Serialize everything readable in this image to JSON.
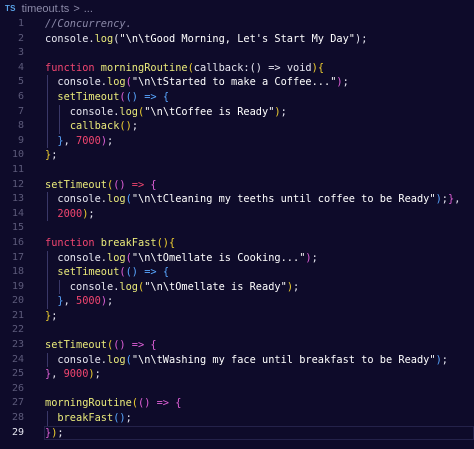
{
  "tab": {
    "language_badge": "TS",
    "filename": "timeout.ts",
    "breadcrumb_sep": ">",
    "breadcrumb_more": "..."
  },
  "lines": [
    {
      "n": "1",
      "tokens": [
        {
          "t": "//Concurrency.",
          "c": "comment"
        }
      ]
    },
    {
      "n": "2",
      "tokens": [
        {
          "t": "console.",
          "c": "plain"
        },
        {
          "t": "log",
          "c": "fn"
        },
        {
          "t": "(",
          "c": "paren"
        },
        {
          "t": "\"\\n\\tGood Morning, Let's Start My Day\"",
          "c": "str"
        },
        {
          "t": ");",
          "c": "plain"
        }
      ]
    },
    {
      "n": "3",
      "tokens": []
    },
    {
      "n": "4",
      "tokens": [
        {
          "t": "function ",
          "c": "kw"
        },
        {
          "t": "morningRoutine",
          "c": "fn"
        },
        {
          "t": "(",
          "c": "brace-y"
        },
        {
          "t": "callback",
          "c": "param"
        },
        {
          "t": ":() => ",
          "c": "plain"
        },
        {
          "t": "void",
          "c": "plain"
        },
        {
          "t": ")",
          "c": "brace-y"
        },
        {
          "t": "{",
          "c": "brace-y"
        }
      ]
    },
    {
      "n": "5",
      "tokens": [
        {
          "t": "  console.",
          "c": "plain"
        },
        {
          "t": "log",
          "c": "fn"
        },
        {
          "t": "(",
          "c": "brace-p"
        },
        {
          "t": "\"\\n\\tStarted to make a Coffee...\"",
          "c": "str"
        },
        {
          "t": ")",
          "c": "brace-p"
        },
        {
          "t": ";",
          "c": "plain"
        }
      ]
    },
    {
      "n": "6",
      "tokens": [
        {
          "t": "  ",
          "c": "plain"
        },
        {
          "t": "setTimeout",
          "c": "fn"
        },
        {
          "t": "(",
          "c": "brace-p"
        },
        {
          "t": "() => ",
          "c": "brace-b"
        },
        {
          "t": "{",
          "c": "brace-b"
        }
      ]
    },
    {
      "n": "7",
      "tokens": [
        {
          "t": "    console.",
          "c": "plain"
        },
        {
          "t": "log",
          "c": "fn"
        },
        {
          "t": "(",
          "c": "brace-y"
        },
        {
          "t": "\"\\n\\tCoffee is Ready\"",
          "c": "str"
        },
        {
          "t": ")",
          "c": "brace-y"
        },
        {
          "t": ";",
          "c": "plain"
        }
      ]
    },
    {
      "n": "8",
      "tokens": [
        {
          "t": "    ",
          "c": "plain"
        },
        {
          "t": "callback",
          "c": "fn"
        },
        {
          "t": "()",
          "c": "brace-y"
        },
        {
          "t": ";",
          "c": "plain"
        }
      ]
    },
    {
      "n": "9",
      "tokens": [
        {
          "t": "  ",
          "c": "plain"
        },
        {
          "t": "}",
          "c": "brace-b"
        },
        {
          "t": ", ",
          "c": "plain"
        },
        {
          "t": "7000",
          "c": "num"
        },
        {
          "t": ")",
          "c": "brace-p"
        },
        {
          "t": ";",
          "c": "plain"
        }
      ]
    },
    {
      "n": "10",
      "tokens": [
        {
          "t": "}",
          "c": "brace-y"
        },
        {
          "t": ";",
          "c": "plain"
        }
      ]
    },
    {
      "n": "11",
      "tokens": []
    },
    {
      "n": "12",
      "tokens": [
        {
          "t": "setTimeout",
          "c": "fn"
        },
        {
          "t": "(",
          "c": "brace-y"
        },
        {
          "t": "()",
          "c": "brace-p"
        },
        {
          "t": " => ",
          "c": "kw"
        },
        {
          "t": "{",
          "c": "brace-p"
        }
      ]
    },
    {
      "n": "13",
      "tokens": [
        {
          "t": "  console.",
          "c": "plain"
        },
        {
          "t": "log",
          "c": "fn"
        },
        {
          "t": "(",
          "c": "brace-b"
        },
        {
          "t": "\"\\n\\tCleaning my teeths until coffee to be Ready\"",
          "c": "str"
        },
        {
          "t": ")",
          "c": "brace-b"
        },
        {
          "t": ";",
          "c": "plain"
        },
        {
          "t": "}",
          "c": "brace-p"
        },
        {
          "t": ",",
          "c": "plain"
        }
      ]
    },
    {
      "n": "14",
      "tokens": [
        {
          "t": "  ",
          "c": "plain"
        },
        {
          "t": "2000",
          "c": "num"
        },
        {
          "t": ")",
          "c": "brace-y"
        },
        {
          "t": ";",
          "c": "plain"
        }
      ]
    },
    {
      "n": "15",
      "tokens": []
    },
    {
      "n": "16",
      "tokens": [
        {
          "t": "function ",
          "c": "kw"
        },
        {
          "t": "breakFast",
          "c": "fn"
        },
        {
          "t": "()",
          "c": "brace-y"
        },
        {
          "t": "{",
          "c": "brace-y"
        }
      ]
    },
    {
      "n": "17",
      "tokens": [
        {
          "t": "  console.",
          "c": "plain"
        },
        {
          "t": "log",
          "c": "fn"
        },
        {
          "t": "(",
          "c": "brace-p"
        },
        {
          "t": "\"\\n\\tOmellate is Cooking...\"",
          "c": "str"
        },
        {
          "t": ")",
          "c": "brace-p"
        },
        {
          "t": ";",
          "c": "plain"
        }
      ]
    },
    {
      "n": "18",
      "tokens": [
        {
          "t": "  ",
          "c": "plain"
        },
        {
          "t": "setTimeout",
          "c": "fn"
        },
        {
          "t": "(",
          "c": "brace-p"
        },
        {
          "t": "() => ",
          "c": "brace-b"
        },
        {
          "t": "{",
          "c": "brace-b"
        }
      ]
    },
    {
      "n": "19",
      "tokens": [
        {
          "t": "    console.",
          "c": "plain"
        },
        {
          "t": "log",
          "c": "fn"
        },
        {
          "t": "(",
          "c": "brace-y"
        },
        {
          "t": "\"\\n\\tOmellate is Ready\"",
          "c": "str"
        },
        {
          "t": ")",
          "c": "brace-y"
        },
        {
          "t": ";",
          "c": "plain"
        }
      ]
    },
    {
      "n": "20",
      "tokens": [
        {
          "t": "  ",
          "c": "plain"
        },
        {
          "t": "}",
          "c": "brace-b"
        },
        {
          "t": ", ",
          "c": "plain"
        },
        {
          "t": "5000",
          "c": "num"
        },
        {
          "t": ")",
          "c": "brace-p"
        },
        {
          "t": ";",
          "c": "plain"
        }
      ]
    },
    {
      "n": "21",
      "tokens": [
        {
          "t": "}",
          "c": "brace-y"
        },
        {
          "t": ";",
          "c": "plain"
        }
      ]
    },
    {
      "n": "22",
      "tokens": []
    },
    {
      "n": "23",
      "tokens": [
        {
          "t": "setTimeout",
          "c": "fn"
        },
        {
          "t": "(",
          "c": "brace-y"
        },
        {
          "t": "() => ",
          "c": "brace-p"
        },
        {
          "t": "{",
          "c": "brace-p"
        }
      ]
    },
    {
      "n": "24",
      "tokens": [
        {
          "t": "  console.",
          "c": "plain"
        },
        {
          "t": "log",
          "c": "fn"
        },
        {
          "t": "(",
          "c": "brace-b"
        },
        {
          "t": "\"\\n\\tWashing my face until breakfast to be Ready\"",
          "c": "str"
        },
        {
          "t": ")",
          "c": "brace-b"
        },
        {
          "t": ";",
          "c": "plain"
        }
      ]
    },
    {
      "n": "25",
      "tokens": [
        {
          "t": "}",
          "c": "brace-p"
        },
        {
          "t": ", ",
          "c": "plain"
        },
        {
          "t": "9000",
          "c": "num"
        },
        {
          "t": ")",
          "c": "brace-y"
        },
        {
          "t": ";",
          "c": "plain"
        }
      ]
    },
    {
      "n": "26",
      "tokens": []
    },
    {
      "n": "27",
      "tokens": [
        {
          "t": "morningRoutine",
          "c": "fn"
        },
        {
          "t": "(",
          "c": "brace-y"
        },
        {
          "t": "() => ",
          "c": "brace-p"
        },
        {
          "t": "{",
          "c": "brace-p"
        }
      ]
    },
    {
      "n": "28",
      "tokens": [
        {
          "t": "  ",
          "c": "plain"
        },
        {
          "t": "breakFast",
          "c": "fn"
        },
        {
          "t": "()",
          "c": "brace-b"
        },
        {
          "t": ";",
          "c": "plain"
        }
      ]
    },
    {
      "n": "29",
      "tokens": [
        {
          "t": "}",
          "c": "brace-p"
        },
        {
          "t": ")",
          "c": "brace-y"
        },
        {
          "t": ";",
          "c": "plain"
        }
      ]
    }
  ],
  "active_line": "29",
  "colors": {
    "background": "#0e0b2a",
    "keyword": "#f0456f",
    "function": "#e9e97a",
    "string": "#ffffff",
    "comment": "#8a88a8"
  }
}
